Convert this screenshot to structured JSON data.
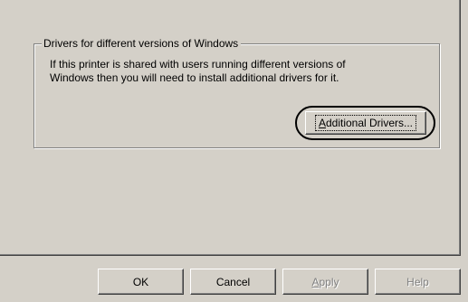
{
  "group": {
    "title": "Drivers for different versions of Windows",
    "description": "If this printer is shared with users running different versions of\nWindows then you will need to install additional drivers for it."
  },
  "buttons": {
    "additional_drivers_prefix": "",
    "additional_drivers_mnemonic": "A",
    "additional_drivers_rest": "dditional Drivers...",
    "ok": "OK",
    "cancel": "Cancel",
    "apply_mnemonic": "A",
    "apply_rest": "pply",
    "help": "Help"
  },
  "states": {
    "apply_enabled": false,
    "help_enabled": false
  }
}
